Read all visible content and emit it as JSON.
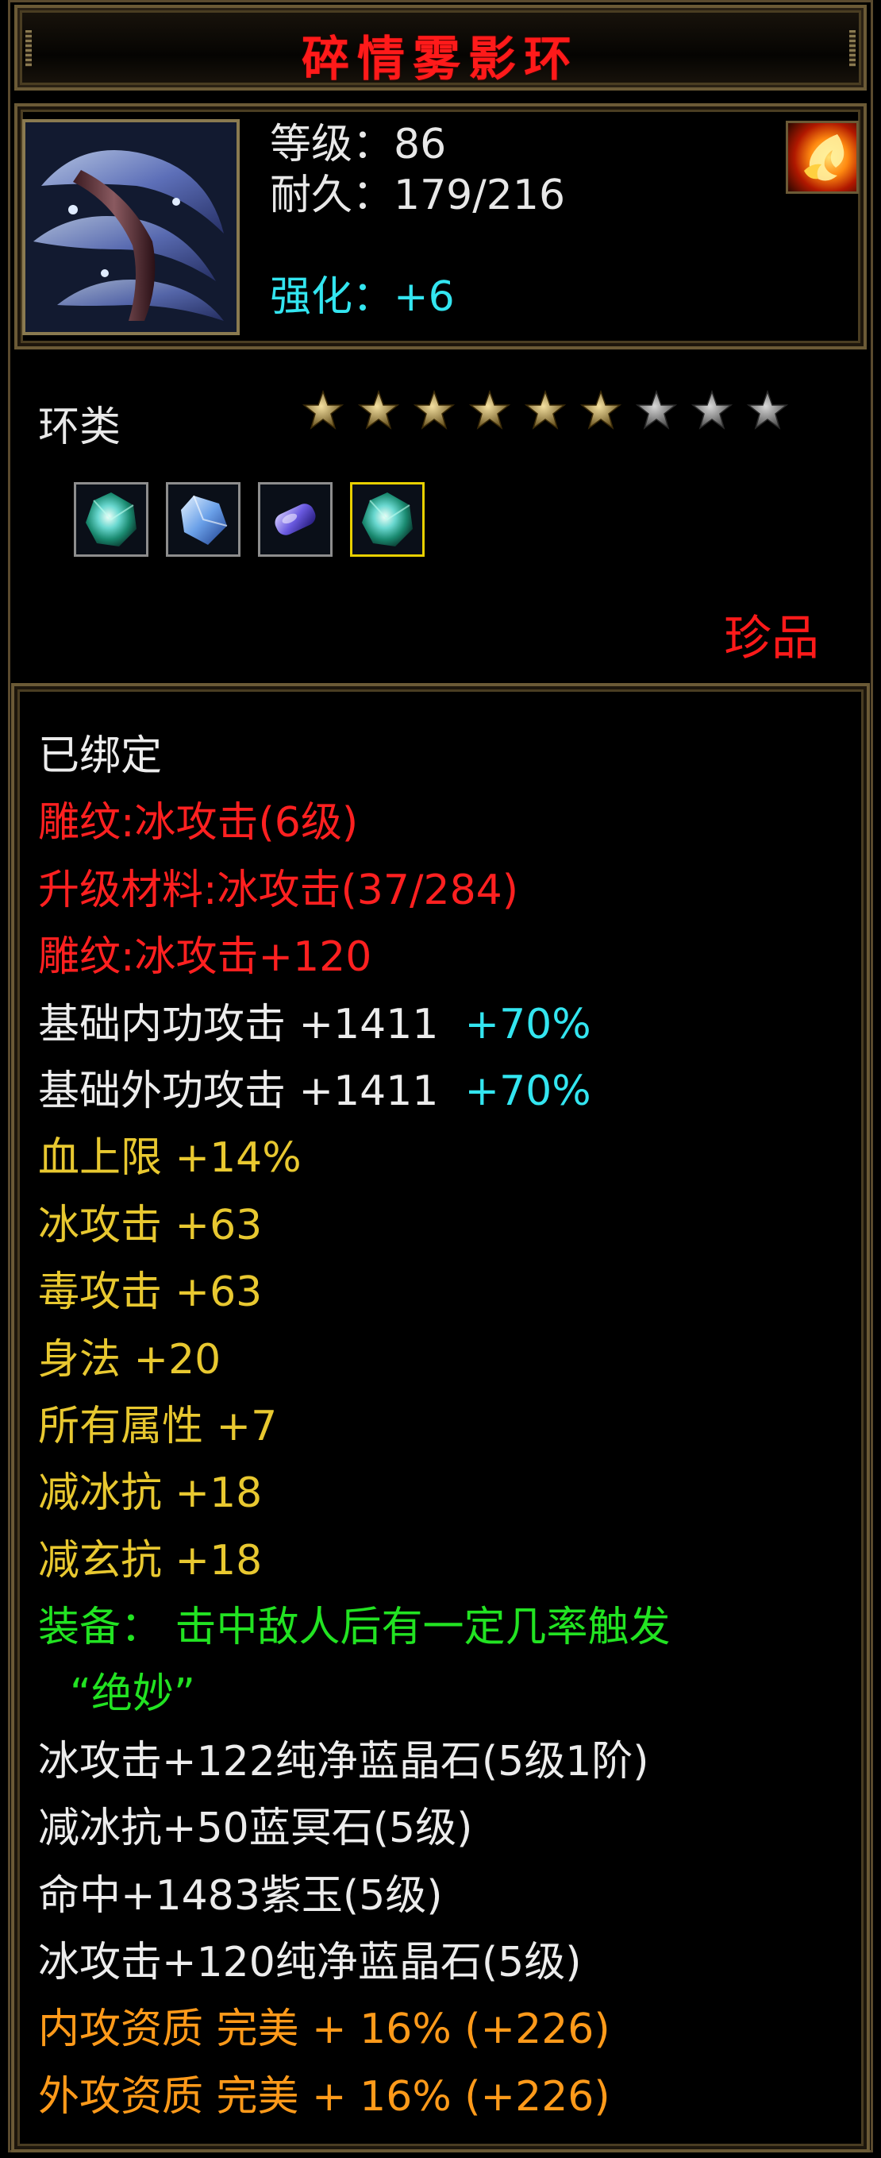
{
  "title": "碎情雾影环",
  "header": {
    "level_label": "等级：",
    "level_value": "86",
    "durability_label": "耐久：",
    "durability_value": "179/216",
    "enhance_label": "强化：",
    "enhance_value": "+6"
  },
  "category": "环类",
  "stars": {
    "filled": 6,
    "total": 9
  },
  "gems": [
    {
      "name": "green-gem-icon",
      "selected": false
    },
    {
      "name": "blue-crystal-gem-icon",
      "selected": false
    },
    {
      "name": "purple-jade-gem-icon",
      "selected": false
    },
    {
      "name": "green-gem-icon",
      "selected": true
    }
  ],
  "rarity": "珍品",
  "colors": {
    "title": "#ff1a1a",
    "white": "#ececec",
    "red": "#ff2020",
    "yellow": "#e8c830",
    "green": "#22e322",
    "orange": "#ff9a1a",
    "cyan": "#33e5f0",
    "frame": "#6b5a36"
  },
  "lines": {
    "bound": "已绑定",
    "engrave1": "雕纹:冰攻击(6级)",
    "upgrade_material": "升级材料:冰攻击(37/284)",
    "engrave2": "雕纹:冰攻击+120",
    "base_inner_attack": "基础内功攻击 +1411",
    "base_inner_attack_bonus": "+70%",
    "base_outer_attack": "基础外功攻击 +1411",
    "base_outer_attack_bonus": "+70%",
    "hp_max": "血上限 +14%",
    "ice_attack": "冰攻击 +63",
    "poison_attack": "毒攻击 +63",
    "agility": "身法 +20",
    "all_attributes": "所有属性 +7",
    "ice_resist_reduce": "减冰抗 +18",
    "mystic_resist_reduce": "减玄抗 +18",
    "equip_effect": "装备：  击中敌人后有一定几率触发",
    "equip_effect_name": "“绝妙”",
    "gem1": "冰攻击+122纯净蓝晶石(5级1阶)",
    "gem2": "减冰抗+50蓝冥石(5级)",
    "gem3": "命中+1483紫玉(5级)",
    "gem4": "冰攻击+120纯净蓝晶石(5级)",
    "inner_quality": "内攻资质 完美 + 16% (+226)",
    "outer_quality": "外攻资质 完美 + 16% (+226)"
  }
}
